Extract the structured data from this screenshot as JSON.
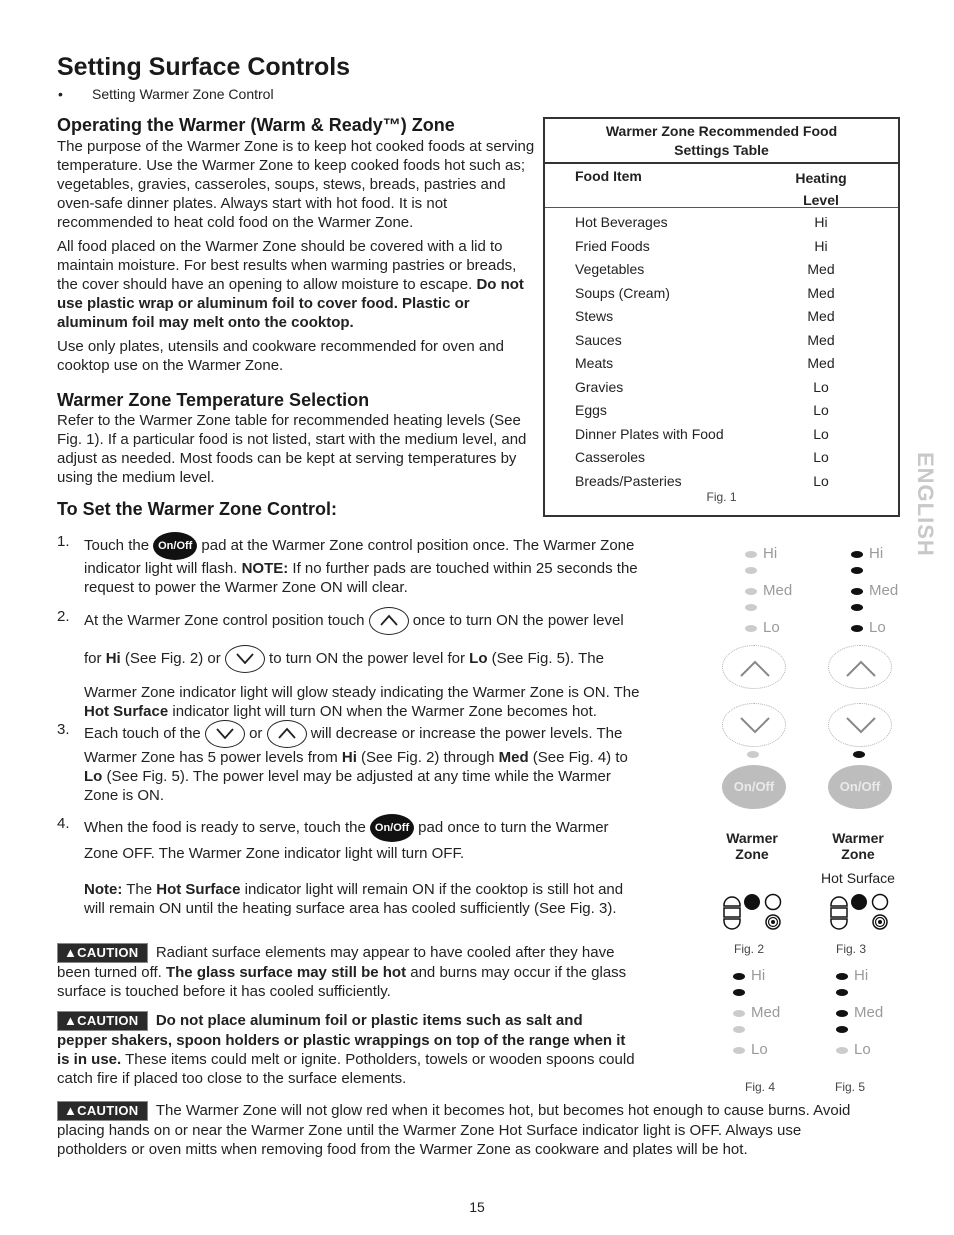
{
  "header": {
    "title": "Setting Surface Controls",
    "bullet": "Setting Warmer Zone Control"
  },
  "section_operating": {
    "heading": "Operating the Warmer (Warm & Ready™) Zone",
    "para1": "The purpose of the Warmer Zone is to keep hot cooked foods at serving temperature. Use the Warmer Zone to keep cooked foods hot such as; vegetables, gravies, casseroles, soups, stews, breads, pastries and oven-safe dinner plates.  Always start with hot food. It is not recommended to heat cold food on the Warmer Zone.",
    "para2_plain": "All food placed on the Warmer Zone should be covered with a lid to maintain moisture.  For best results when warming pastries or breads, the cover should have an opening to allow moisture to escape. ",
    "para2_bold": "Do not use plastic wrap or aluminum foil to cover food. Plastic or aluminum foil may melt onto the cooktop.",
    "para3": "Use only plates, utensils and cookware recommended for oven and cooktop use on the Warmer Zone."
  },
  "section_temperature": {
    "heading": "Warmer Zone Temperature Selection",
    "para": "Refer to the Warmer Zone table for recommended heating levels (See Fig. 1). If a particular food is not listed, start with the medium level, and adjust as needed. Most foods can be kept at serving temperatures by using the medium level."
  },
  "section_set": {
    "heading": "To Set the Warmer Zone Control:",
    "onoff_label": "On/Off",
    "steps": [
      {
        "num": "1.",
        "a": "Touch the ",
        "b": " pad at the Warmer Zone control position once. The Warmer Zone",
        "c": "indicator light will flash. ",
        "c_bold": "NOTE:",
        "d": " If no further pads are touched within 25 seconds the",
        "e": "request to power the Warmer Zone ON will clear."
      },
      {
        "num": "2.",
        "a": "At the Warmer Zone control position touch ",
        "b": " once to turn ON the power level",
        "c1": "for ",
        "c_hi": "Hi",
        "c2": " (See Fig. 2) or ",
        "c3": " to turn ON the power level for ",
        "c_lo": "Lo",
        "c4": " (See Fig. 5). The",
        "d": "Warmer Zone indicator light will glow steady indicating the Warmer Zone is ON. The",
        "e_bold": "Hot Surface",
        "e": " indicator light will turn ON when the Warmer Zone becomes hot."
      },
      {
        "num": "3.",
        "a": "Each touch of the ",
        "b": " or ",
        "c": " will decrease or increase the power levels. The",
        "d1": "Warmer Zone has 5 power levels from ",
        "d_hi": "Hi",
        "d2": " (See Fig. 2) through ",
        "d_med": "Med",
        "d3": " (See Fig. 4) to",
        "e_lo": "Lo",
        "e": " (See Fig. 5). The power level may be adjusted at any time while the Warmer",
        "f": "Zone is ON."
      },
      {
        "num": "4.",
        "a": "When the food is ready to serve, touch the ",
        "b": " pad once to turn the Warmer",
        "c": "Zone OFF. The Warmer Zone indicator light will turn OFF."
      }
    ],
    "note_bold": "Note:",
    "note_a": " The ",
    "note_hot": "Hot Surface",
    "note_b": " indicator light will remain ON if the cooktop is still hot and",
    "note_c": "will remain ON until the heating surface area has cooled sufficiently (See Fig. 3)."
  },
  "cautions": {
    "badge": "CAUTION",
    "c1_a": "Radiant surface elements may appear to have cooled after they have",
    "c1_b": "been turned off. ",
    "c1_bold": "The glass surface may still be hot",
    "c1_c": " and burns may occur if the glass",
    "c1_d": "surface is touched before it has cooled sufficiently.",
    "c2_bold_a": "Do not place aluminum foil or plastic items such as salt and",
    "c2_bold_b": "pepper shakers, spoon holders or plastic wrappings on top of the range when it",
    "c2_bold_c": "is in use.",
    "c2_c": " These items could melt or ignite. Potholders, towels or wooden spoons could",
    "c2_d": "catch fire if placed too close to the surface elements.",
    "c3_a": "The Warmer Zone will not glow red when it becomes hot, but becomes hot enough to cause burns. Avoid",
    "c3_b": "placing hands on or near the Warmer Zone until the Warmer Zone Hot Surface indicator light is OFF. Always use",
    "c3_c": "potholders or oven mitts when removing food from the Warmer Zone as cookware and plates will be hot."
  },
  "table": {
    "title_line1": "Warmer Zone Recommended Food",
    "title_line2": "Settings Table",
    "col_food": "Food Item",
    "col_level_1": "Heating",
    "col_level_2": "Level",
    "rows": [
      {
        "food": "Hot Beverages",
        "level": "Hi"
      },
      {
        "food": "Fried Foods",
        "level": "Hi"
      },
      {
        "food": "Vegetables",
        "level": "Med"
      },
      {
        "food": "Soups (Cream)",
        "level": "Med"
      },
      {
        "food": "Stews",
        "level": "Med"
      },
      {
        "food": "Sauces",
        "level": "Med"
      },
      {
        "food": "Meats",
        "level": "Med"
      },
      {
        "food": "Gravies",
        "level": "Lo"
      },
      {
        "food": "Eggs",
        "level": "Lo"
      },
      {
        "food": "Dinner Plates with Food",
        "level": "Lo"
      },
      {
        "food": "Casseroles",
        "level": "Lo"
      },
      {
        "food": "Breads/Pasteries",
        "level": "Lo"
      }
    ],
    "caption": "Fig. 1"
  },
  "side_tab": "ENGLISH",
  "figures": {
    "level_labels": [
      "Hi",
      "",
      "Med",
      "",
      "Lo"
    ],
    "onoff_label": "On/Off",
    "zone_label_1": "Warmer",
    "zone_label_2": "Zone",
    "hot_surface_label": "Hot Surface",
    "panel_left_leds": [
      false,
      false,
      false,
      false,
      false
    ],
    "panel_left_zone_led": false,
    "panel_right_leds": [
      true,
      true,
      true,
      true,
      true
    ],
    "panel_right_zone_led": true,
    "fig2": "Fig. 2",
    "fig3": "Fig. 3",
    "fig4": "Fig. 4",
    "fig5": "Fig. 5",
    "fig4_leds": [
      true,
      true,
      false,
      false,
      false
    ],
    "fig5_leds": [
      true,
      true,
      true,
      true,
      false
    ]
  },
  "page_number": "15"
}
